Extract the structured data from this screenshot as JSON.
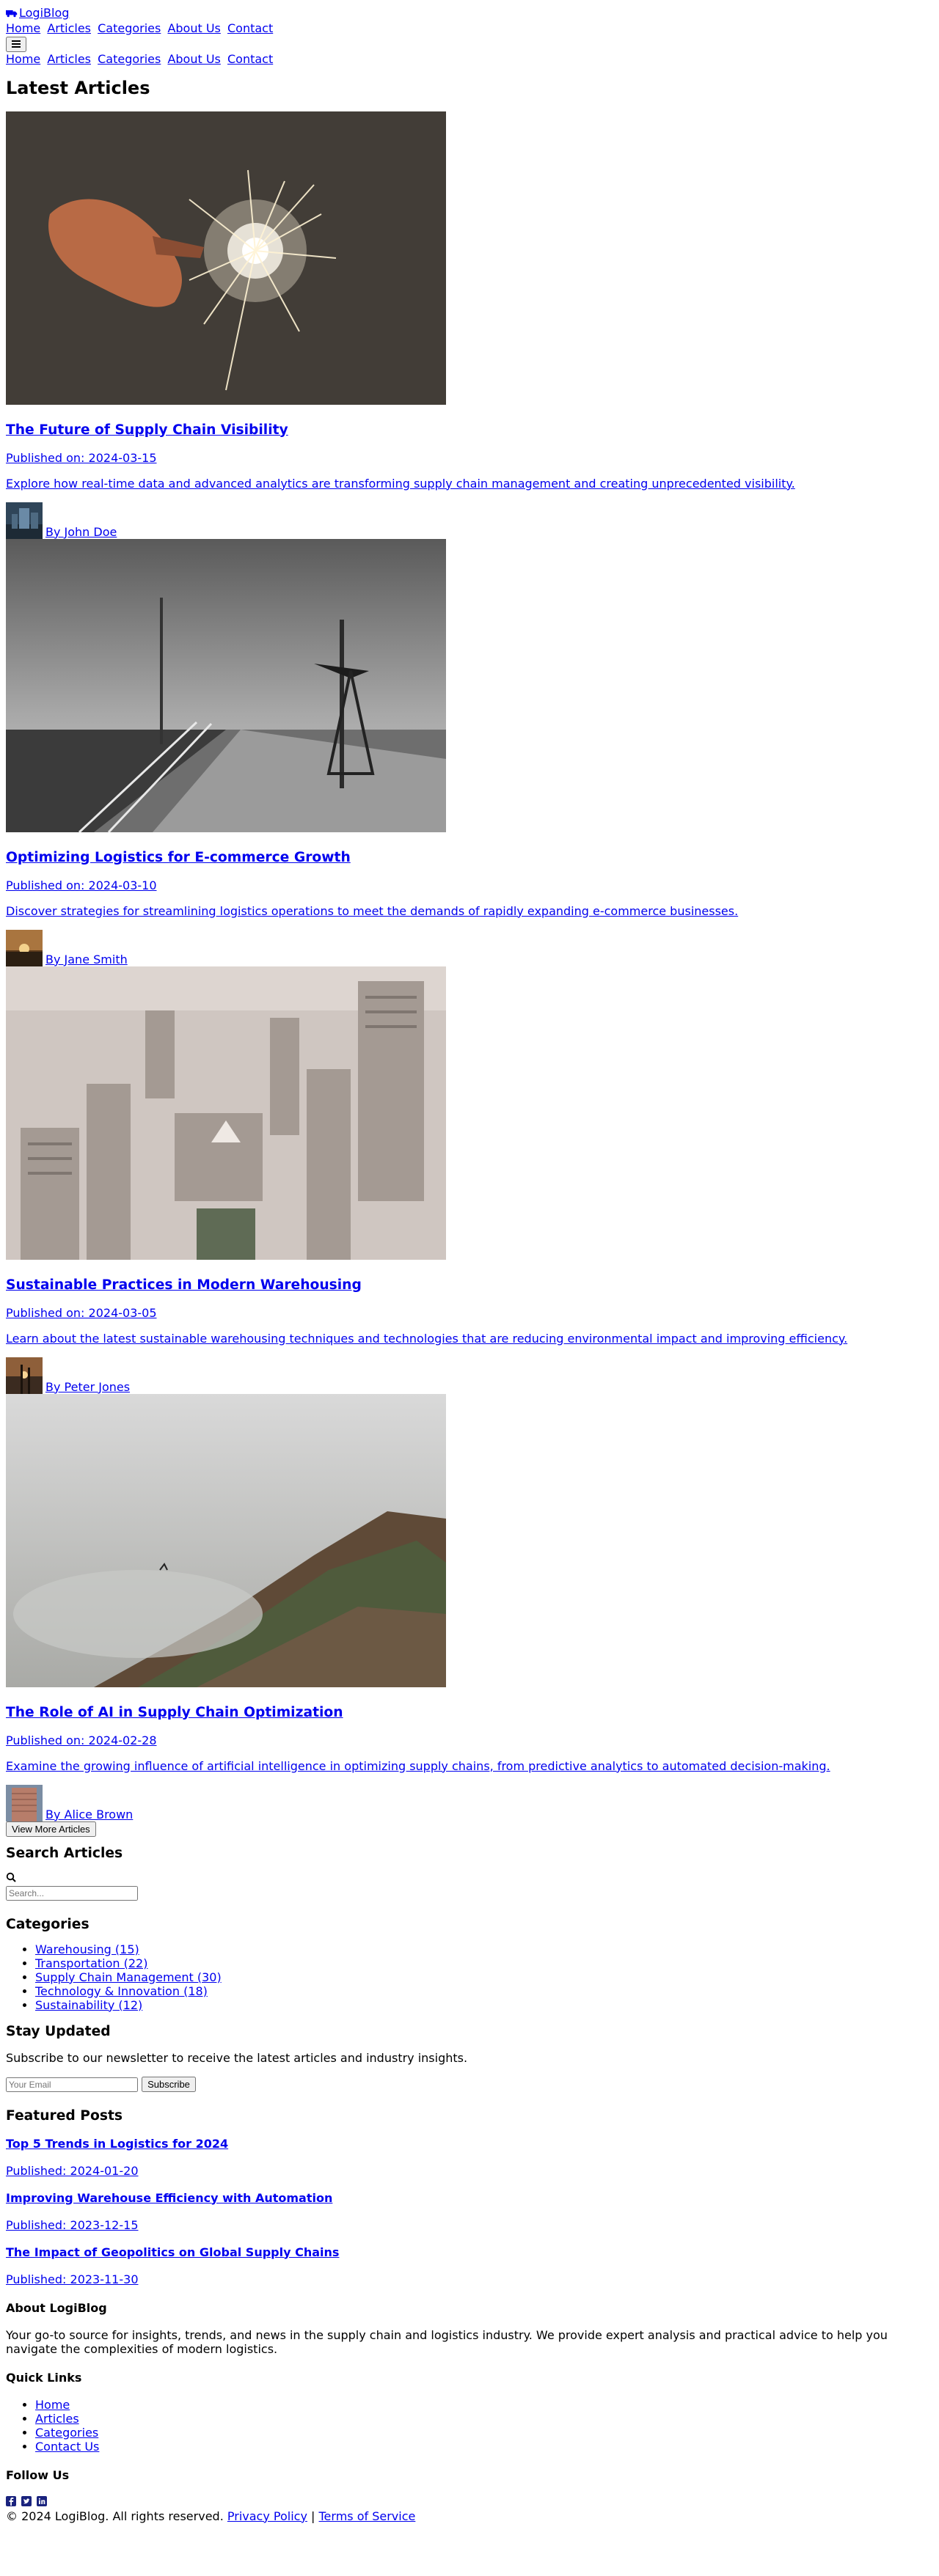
{
  "header": {
    "brand": "LogiBlog",
    "nav_primary": [
      "Home",
      "Articles",
      "Categories",
      "About Us",
      "Contact"
    ],
    "nav_secondary": [
      "Home",
      "Articles",
      "Categories",
      "About Us",
      "Contact"
    ],
    "menu_icon": "bars-icon"
  },
  "main": {
    "section_title": "Latest Articles",
    "articles": [
      {
        "title": "The Future of Supply Chain Visibility",
        "published": "Published on: 2024-03-15",
        "excerpt": "Explore how real-time data and advanced analytics are transforming supply chain management and creating unprecedented visibility.",
        "author": "By John Doe"
      },
      {
        "title": "Optimizing Logistics for E-commerce Growth",
        "published": "Published on: 2024-03-10",
        "excerpt": "Discover strategies for streamlining logistics operations to meet the demands of rapidly expanding e-commerce businesses.",
        "author": "By Jane Smith"
      },
      {
        "title": "Sustainable Practices in Modern Warehousing",
        "published": "Published on: 2024-03-05",
        "excerpt": "Learn about the latest sustainable warehousing techniques and technologies that are reducing environmental impact and improving efficiency.",
        "author": "By Peter Jones"
      },
      {
        "title": "The Role of AI in Supply Chain Optimization",
        "published": "Published on: 2024-02-28",
        "excerpt": "Examine the growing influence of artificial intelligence in optimizing supply chains, from predictive analytics to automated decision-making.",
        "author": "By Alice Brown"
      }
    ],
    "view_more": "View More Articles"
  },
  "sidebar": {
    "search_title": "Search Articles",
    "search_placeholder": "Search...",
    "categories_title": "Categories",
    "categories": [
      "Warehousing (15)",
      "Transportation (22)",
      "Supply Chain Management (30)",
      "Technology & Innovation (18)",
      "Sustainability (12)"
    ],
    "newsletter_title": "Stay Updated",
    "newsletter_text": "Subscribe to our newsletter to receive the latest articles and industry insights.",
    "email_placeholder": "Your Email",
    "subscribe": "Subscribe",
    "featured_title": "Featured Posts",
    "featured": [
      {
        "title": "Top 5 Trends in Logistics for 2024",
        "date": "Published: 2024-01-20"
      },
      {
        "title": "Improving Warehouse Efficiency with Automation",
        "date": "Published: 2023-12-15"
      },
      {
        "title": "The Impact of Geopolitics on Global Supply Chains",
        "date": "Published: 2023-11-30"
      }
    ]
  },
  "footer": {
    "about_title": "About LogiBlog",
    "about_text": "Your go-to source for insights, trends, and news in the supply chain and logistics industry. We provide expert analysis and practical advice to help you navigate the complexities of modern logistics.",
    "quick_links_title": "Quick Links",
    "quick_links": [
      "Home",
      "Articles",
      "Categories",
      "Contact Us"
    ],
    "follow_title": "Follow Us",
    "social_icons": [
      "facebook-icon",
      "twitter-icon",
      "linkedin-icon"
    ],
    "copyright": "© 2024 LogiBlog. All rights reserved.",
    "separator": "|",
    "privacy": "Privacy Policy",
    "terms": "Terms of Service"
  },
  "colors": {
    "link": "#0000ee",
    "text": "#000000",
    "social": "#1a237e"
  }
}
